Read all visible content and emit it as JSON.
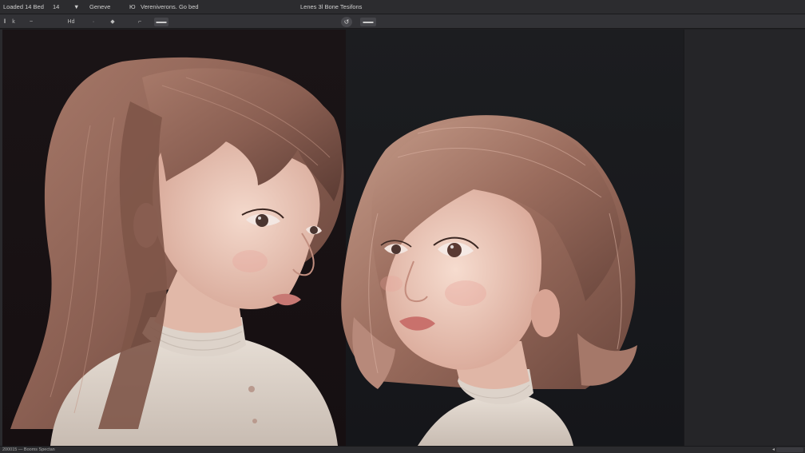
{
  "menubar": {
    "items": [
      {
        "label": "Loaded 14 Bed"
      },
      {
        "label": "14"
      },
      {
        "label": "▪"
      },
      {
        "label": "▼"
      },
      {
        "label": "Geneve"
      },
      {
        "label": "Ю"
      },
      {
        "label": "Vereniverons. Go bed"
      },
      {
        "label": "Lenes 3l Bone Tesifons"
      },
      {
        "label": "▪"
      },
      {
        "label": "Tesifons"
      }
    ]
  },
  "toolbar": {
    "tools": [
      {
        "label": "‖"
      },
      {
        "label": "k"
      },
      {
        "label": "~"
      },
      {
        "label": "Hd"
      },
      {
        "label": "·"
      },
      {
        "label": "◆"
      },
      {
        "label": "⌐"
      },
      {
        "label": "▬▬"
      },
      {
        "label": "↺"
      },
      {
        "label": "▬▬"
      }
    ]
  },
  "statusbar": {
    "text": "200015 — Booms Spectan"
  },
  "colors": {
    "menubar": "#2c2c2f",
    "toolbar": "#323236",
    "canvas": "#141416",
    "panel": "#252528",
    "hair": "#8a5f52",
    "skin": "#e6c2b4",
    "sweater": "#dcd3cb"
  }
}
